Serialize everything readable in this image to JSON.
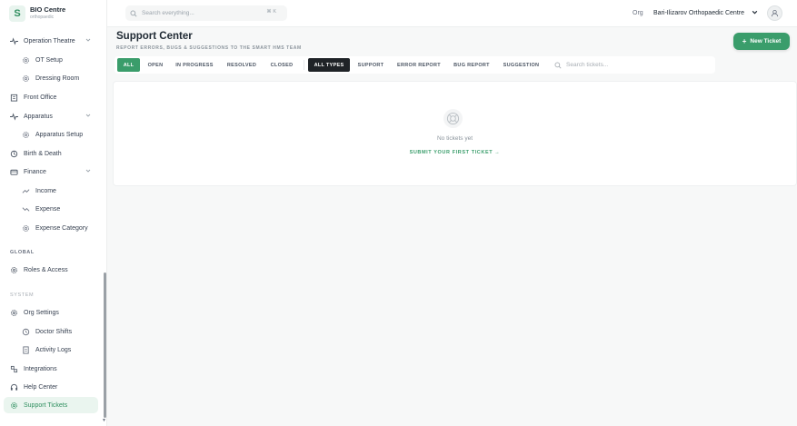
{
  "brand": {
    "name": "BIO Centre",
    "subtitle": "orthopaedic"
  },
  "sidebar": {
    "items": [
      {
        "label": "Operation Theatre",
        "icon": "pulse-icon",
        "chevron": "⌄"
      },
      {
        "label": "OT Setup",
        "icon": "gear-icon"
      },
      {
        "label": "Dressing Room",
        "icon": "gear-icon"
      },
      {
        "label": "Front Office",
        "icon": "building-icon"
      },
      {
        "label": "Apparatus",
        "icon": "pulse-icon",
        "chevron": "⌄"
      },
      {
        "label": "Apparatus Setup",
        "icon": "gear-icon"
      },
      {
        "label": "Birth & Death",
        "icon": "cycle-icon"
      },
      {
        "label": "Finance",
        "icon": "wallet-icon",
        "chevron": "⌄"
      },
      {
        "label": "Income",
        "icon": "trend-up-icon"
      },
      {
        "label": "Expense",
        "icon": "trend-down-icon"
      },
      {
        "label": "Expense Category",
        "icon": "gear-icon"
      }
    ],
    "global_label": "GLOBAL",
    "global_items": [
      {
        "label": "Roles & Access",
        "icon": "gear-icon"
      }
    ],
    "system_label": "SYSTEM",
    "system_items": [
      {
        "label": "Org Settings",
        "icon": "gear-icon"
      },
      {
        "label": "Doctor Shifts",
        "icon": "clock-icon"
      },
      {
        "label": "Activity Logs",
        "icon": "document-icon"
      },
      {
        "label": "Integrations",
        "icon": "plug-icon"
      },
      {
        "label": "Help Center",
        "icon": "headset-icon"
      },
      {
        "label": "Support Tickets",
        "icon": "gear-icon"
      }
    ]
  },
  "header": {
    "search_placeholder": "Search everything...",
    "shortcut": "⌘ K",
    "org_label": "Org",
    "org_name": "Bari-Ilizarov Orthopaedic Centre",
    "chevron": "⌄"
  },
  "main": {
    "title": "Support Center",
    "subtitle": "REPORT ERRORS, BUGS & SUGGESTIONS TO THE SMART HMS TEAM",
    "new_ticket_label": "New Ticket",
    "plus": "+",
    "status_filters": [
      "ALL",
      "OPEN",
      "IN PROGRESS",
      "RESOLVED",
      "CLOSED"
    ],
    "type_filters": [
      "ALL TYPES",
      "SUPPORT",
      "ERROR REPORT",
      "BUG REPORT",
      "SUGGESTION"
    ],
    "search_placeholder": "Search tickets...",
    "empty_text": "No tickets yet",
    "empty_link": "SUBMIT YOUR FIRST TICKET →"
  },
  "colors": {
    "accent": "#3a9d6b",
    "dark_chip": "#1f2327",
    "active_nav_bg": "#eaf5ef"
  }
}
